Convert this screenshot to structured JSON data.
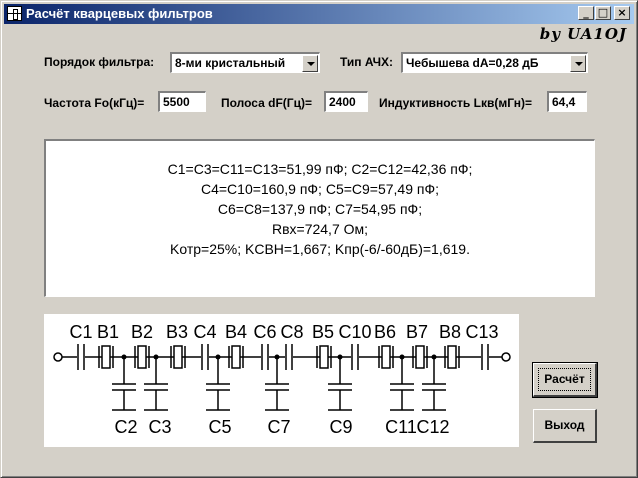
{
  "window": {
    "title": "Расчёт кварцевых фильтров",
    "buttons": {
      "minimize": "_",
      "maximize": "□",
      "close": "×"
    }
  },
  "signature": "by UA1OJ",
  "form": {
    "order_label": "Порядок фильтра:",
    "order_value": "8-ми кристальный",
    "response_label": "Тип АЧХ:",
    "response_value": "Чебышева dA=0,28 дБ",
    "freq_label": "Частота Fo(кГц)=",
    "freq_value": "5500",
    "band_label": "Полоса dF(Гц)=",
    "band_value": "2400",
    "induct_label": "Индуктивность Lкв(мГн)=",
    "induct_value": "64,4"
  },
  "results": [
    "C1=C3=C11=C13=51,99 пФ;   C2=C12=42,36 пФ;",
    "C4=C10=160,9 пФ;  C5=C9=57,49 пФ;",
    "C6=C8=137,9 пФ;   C7=54,95 пФ;",
    "Rвх=724,7 Ом;",
    "Kотр=25%;   KCBH=1,667;  Kпр(-6/-60дБ)=1,619."
  ],
  "schematic": {
    "top_labels": [
      "C1",
      "B1",
      "B2",
      "B3",
      "C4",
      "B4",
      "C6",
      "C8",
      "B5",
      "C10",
      "B6",
      "B7",
      "B8",
      "C13"
    ],
    "bottom_labels": [
      "C2",
      "C3",
      "C5",
      "C7",
      "C9",
      "C11",
      "C12"
    ]
  },
  "buttons": {
    "calc": "Расчёт",
    "exit": "Выход"
  },
  "colors": {
    "titlebar_start": "#0a246a",
    "titlebar_end": "#a6caf0",
    "face": "#d4d0c8"
  }
}
